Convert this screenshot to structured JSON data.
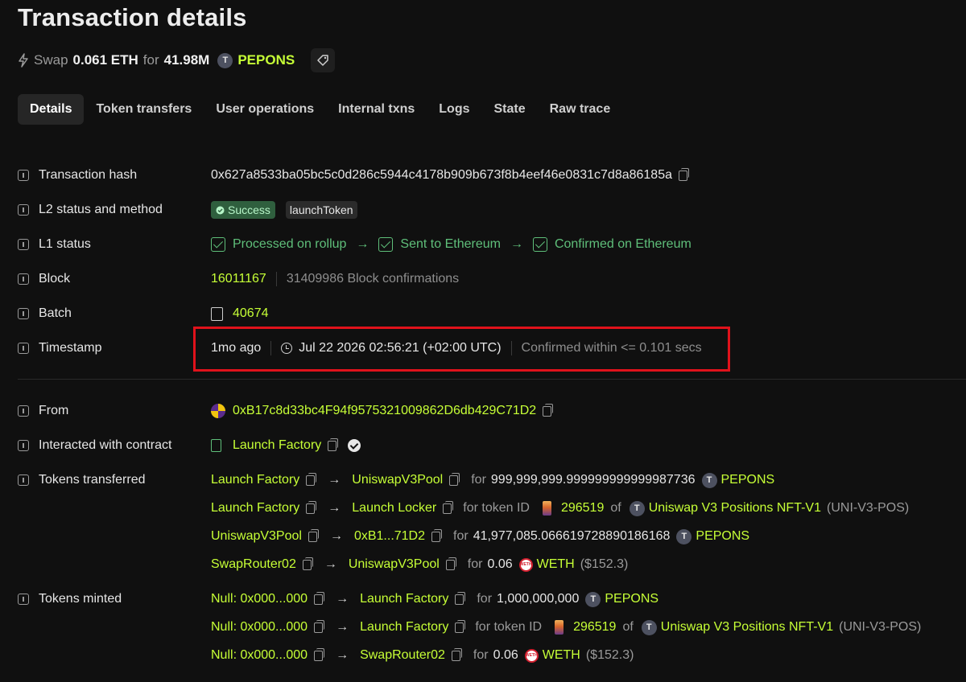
{
  "page": {
    "title": "Transaction details"
  },
  "subtitle": {
    "action": "Swap",
    "amount_in": "0.061 ETH",
    "for_word": "for",
    "amount_out": "41.98M",
    "token_icon_letter": "T",
    "token": "PEPONS"
  },
  "tabs": [
    "Details",
    "Token transfers",
    "User operations",
    "Internal txns",
    "Logs",
    "State",
    "Raw trace"
  ],
  "fields": {
    "tx_hash": {
      "label": "Transaction hash",
      "value": "0x627a8533ba05bc5c0d286c5944c4178b909b673f8b4eef46e0831c7d8a86185a"
    },
    "l2_status": {
      "label": "L2 status and method",
      "status": "Success",
      "method": "launchToken"
    },
    "l1_status": {
      "label": "L1 status",
      "steps": [
        "Processed on rollup",
        "Sent to Ethereum",
        "Confirmed on Ethereum"
      ],
      "arrow": "→"
    },
    "block": {
      "label": "Block",
      "number": "16011167",
      "confirmations": "31409986 Block confirmations"
    },
    "batch": {
      "label": "Batch",
      "number": "40674"
    },
    "timestamp": {
      "label": "Timestamp",
      "ago": "1mo ago",
      "datetime": "Jul 22 2026 02:56:21 (+02:00 UTC)",
      "confirmed": "Confirmed within <= 0.101 secs"
    },
    "from": {
      "label": "From",
      "address": "0xB17c8d33bc4F94f9575321009862D6db429C71D2"
    },
    "contract": {
      "label": "Interacted with contract",
      "name": "Launch Factory"
    }
  },
  "tokens_transferred": {
    "label": "Tokens transferred",
    "rows": [
      {
        "from": "Launch Factory",
        "to": "UniswapV3Pool",
        "for": "for",
        "amount": "999,999,999.999999999999987736",
        "token": "PEPONS",
        "token_icon": "T"
      },
      {
        "from": "Launch Factory",
        "to": "Launch Locker",
        "for": "for token ID",
        "token_id": "296519",
        "of": "of",
        "token": "Uniswap V3 Positions NFT-V1",
        "symbol": "(UNI-V3-POS)",
        "token_icon": "T"
      },
      {
        "from": "UniswapV3Pool",
        "to": "0xB1...71D2",
        "for": "for",
        "amount": "41,977,085.066619728890186168",
        "token": "PEPONS",
        "token_icon": "T"
      },
      {
        "from": "SwapRouter02",
        "to": "UniswapV3Pool",
        "for": "for",
        "amount": "0.06",
        "token": "WETH",
        "usd": "($152.3)",
        "weth_icon_text": "WETH"
      }
    ]
  },
  "tokens_minted": {
    "label": "Tokens minted",
    "rows": [
      {
        "from": "Null: 0x000...000",
        "to": "Launch Factory",
        "for": "for",
        "amount": "1,000,000,000",
        "token": "PEPONS",
        "token_icon": "T"
      },
      {
        "from": "Null: 0x000...000",
        "to": "Launch Factory",
        "for": "for token ID",
        "token_id": "296519",
        "of": "of",
        "token": "Uniswap V3 Positions NFT-V1",
        "symbol": "(UNI-V3-POS)",
        "token_icon": "T"
      },
      {
        "from": "Null: 0x000...000",
        "to": "SwapRouter02",
        "for": "for",
        "amount": "0.06",
        "token": "WETH",
        "usd": "($152.3)",
        "weth_icon_text": "WETH"
      }
    ]
  },
  "colors": {
    "accent_green": "#c6ff36",
    "status_green": "#5fbf7a",
    "highlight_red": "#e0121b",
    "background": "#101010"
  },
  "icons": [
    "bolt-icon",
    "tag-icon",
    "info-icon",
    "copy-icon",
    "check-icon",
    "clock-icon",
    "file-icon",
    "batch-icon",
    "verified-icon",
    "token-icon",
    "weth-icon"
  ]
}
